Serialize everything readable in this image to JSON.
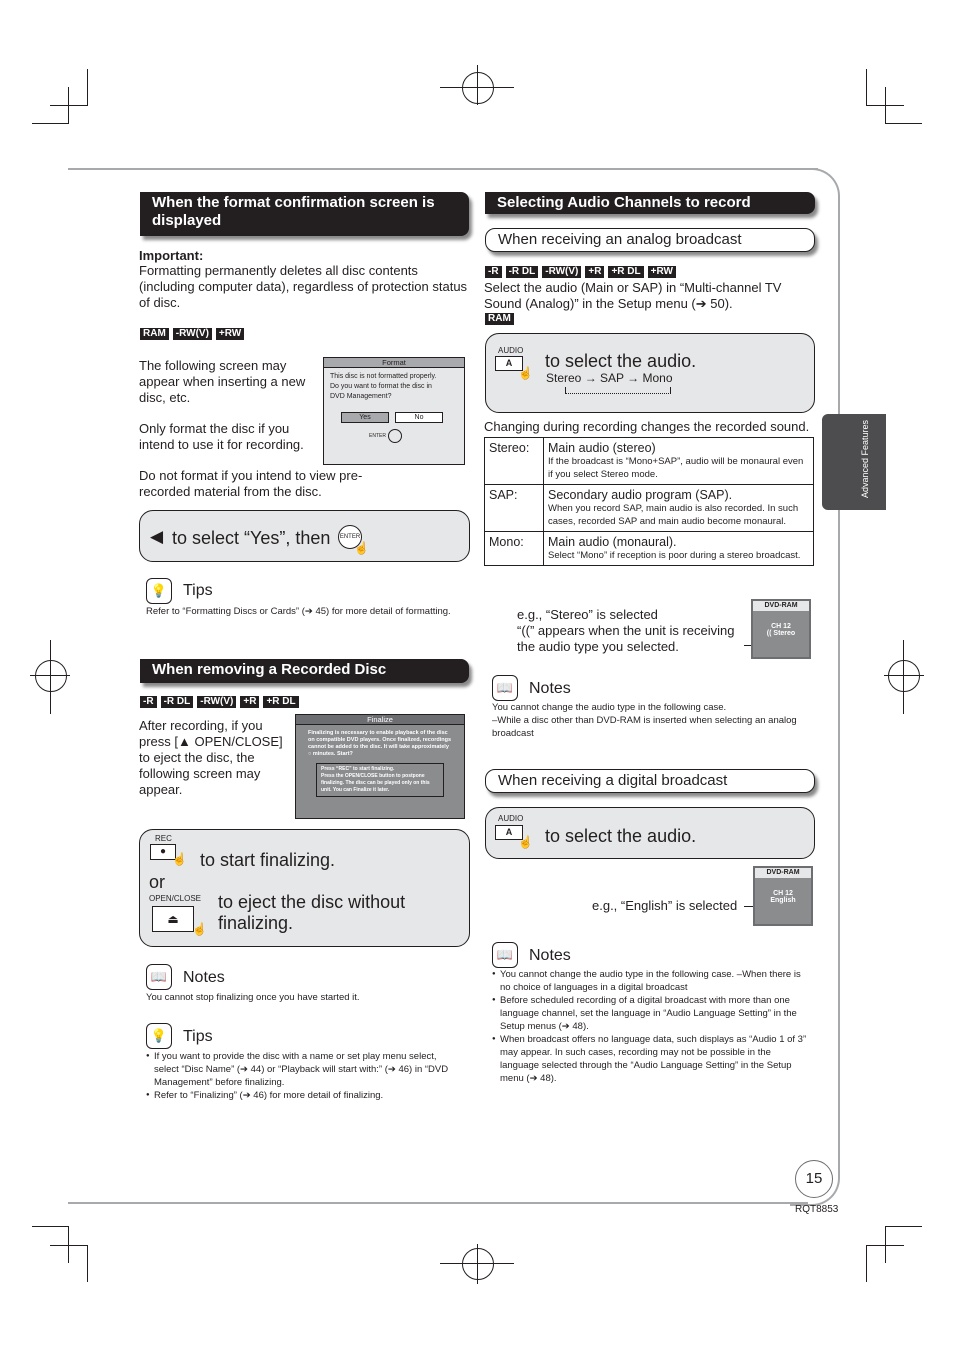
{
  "page": {
    "number": "15",
    "code": "RQT8853",
    "side_tab": "Advanced Features"
  },
  "left": {
    "format": {
      "heading": "When the format confirmation screen is displayed",
      "important_label": "Important:",
      "important_text": "Formatting permanently deletes all disc contents (including computer data), regardless of protection status of disc.",
      "badges": [
        "RAM",
        "-RW(V)",
        "+RW"
      ],
      "para1": "The following screen may appear when inserting a new disc, etc.",
      "para2": "Only format the disc if you intend to use it for recording.",
      "para3": "Do not format if you intend to view pre-recorded material from the disc.",
      "osd": {
        "title": "Format",
        "message": "This disc is not formatted properly. Do you want to format the disc in DVD Management?",
        "yes": "Yes",
        "no": "No",
        "enter": "ENTER"
      },
      "instruction_arrow": "◀",
      "instruction": "to select “Yes”, then",
      "enter_button": "ENTER",
      "tips_title": "Tips",
      "tips_text": "Refer to “Formatting Discs or Cards” (➔ 45) for more detail of formatting."
    },
    "remove": {
      "heading": "When removing a Recorded Disc",
      "badges": [
        "-R",
        "-R DL",
        "-RW(V)",
        "+R",
        "+R DL"
      ],
      "para": "After recording, if you press [▲ OPEN/CLOSE] to eject the disc, the following screen may appear.",
      "osd": {
        "title": "Finalize",
        "message": "Finalizing is necessary to enable playback of the disc on compatible DVD players. Once finalized, recordings cannot be added to the disc. It will take approximately ○ minutes. Start?",
        "option1": "Press “REC” to start finalizing.",
        "option2": "Press the OPEN/CLOSE button to postpone finalizing. The disc can be played only on this unit. You can Finalize it later."
      },
      "rec_label": "REC",
      "rec_text": "to start finalizing.",
      "or": "or",
      "open_label": "OPEN/CLOSE",
      "open_text": "to eject the disc without finalizing.",
      "notes_title": "Notes",
      "notes_text": "You cannot stop finalizing once you have started it.",
      "tips_title": "Tips",
      "tips": [
        "If you want to provide the disc with a name or set play menu select, select “Disc Name” (➔ 44) or “Playback will start with:” (➔ 46) in “DVD Management” before finalizing.",
        "Refer to “Finalizing” (➔ 46) for more detail of finalizing."
      ]
    }
  },
  "right": {
    "heading": "Selecting Audio Channels to record",
    "analog": {
      "subheading": "When receiving an analog broadcast",
      "badges": [
        "-R",
        "-R DL",
        "-RW(V)",
        "+R",
        "+R DL",
        "+RW"
      ],
      "para": "Select the audio (Main or SAP) in “Multi-channel TV Sound (Analog)” in the Setup menu (➔ 50).",
      "badge_ram": "RAM",
      "audio_label": "AUDIO",
      "audio_key": "A",
      "instruction": "to select the audio.",
      "cycle": "Stereo → SAP → Mono",
      "changing": "Changing during recording changes the recorded sound.",
      "table": [
        {
          "mode": "Stereo:",
          "main": "Main audio (stereo)",
          "detail": "If the broadcast is “Mono+SAP”, audio will be monaural even if you select Stereo mode."
        },
        {
          "mode": "SAP:",
          "main": "Secondary audio program (SAP).",
          "detail": "When you record SAP, main audio is also recorded. In such cases, recorded SAP and main audio become monaural."
        },
        {
          "mode": "Mono:",
          "main": "Main audio (monaural).",
          "detail": "Select “Mono” if reception is poor during a stereo broadcast."
        }
      ],
      "example1": "e.g., “Stereo” is selected",
      "example2": "“((” appears when the unit is receiving the audio type you selected.",
      "display": {
        "title": "DVD-RAM",
        "ch": "CH 12",
        "audio": "(( Stereo"
      },
      "notes_title": "Notes",
      "notes_lines": [
        "You cannot change the audio type in the following case.",
        "–While a disc other than DVD-RAM is inserted when selecting an analog broadcast"
      ]
    },
    "digital": {
      "subheading": "When receiving a digital broadcast",
      "audio_label": "AUDIO",
      "audio_key": "A",
      "instruction": "to select the audio.",
      "example": "e.g., “English” is selected",
      "display": {
        "title": "DVD-RAM",
        "ch": "CH 12",
        "audio": "English"
      },
      "notes_title": "Notes",
      "notes": [
        "You cannot change the audio type in the following case. –When there is no choice of languages in a digital broadcast",
        "Before scheduled recording of a digital broadcast with more than one language channel, set the language in “Audio Language Setting” in the Setup menus (➔ 48).",
        "When broadcast offers no language data, such displays as “Audio 1 of 3” may appear. In such cases, recording may not be possible in the language selected through the “Audio Language Setting” in the Setup menu (➔ 48)."
      ]
    }
  }
}
